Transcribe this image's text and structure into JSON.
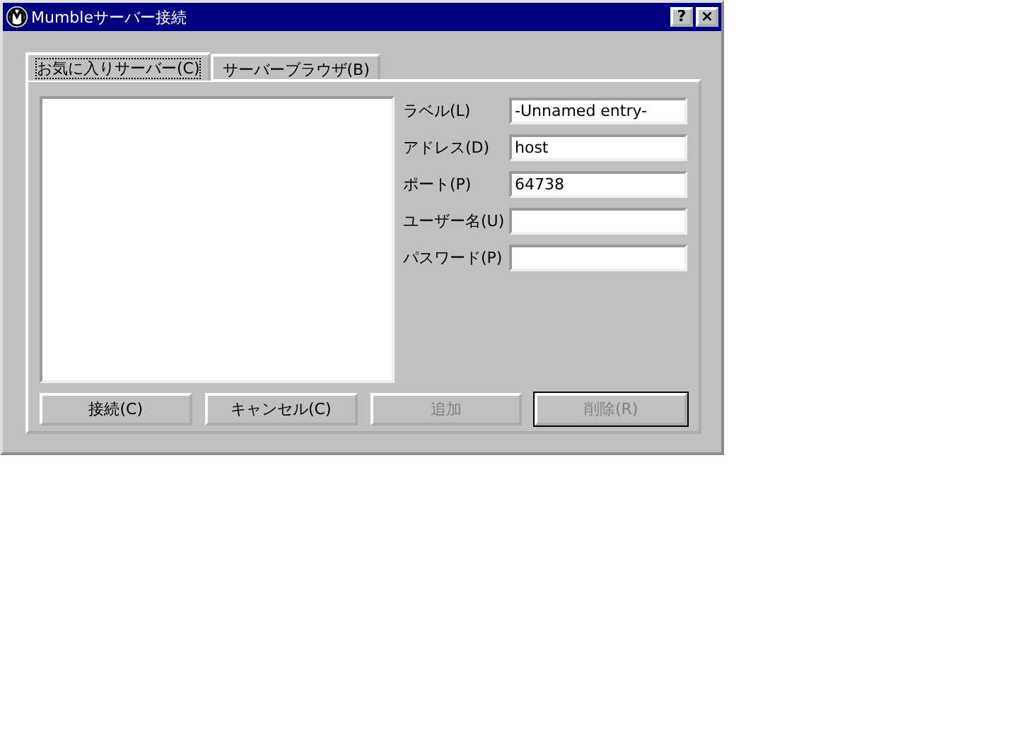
{
  "window": {
    "title": "Mumbleサーバー接続",
    "help": "?",
    "close": "×"
  },
  "tabs": [
    {
      "label": "お気に入りサーバー(C)",
      "selected": true
    },
    {
      "label": "サーバーブラウザ(B)",
      "selected": false
    }
  ],
  "fields": [
    {
      "label": "ラベル(L)",
      "value": "-Unnamed entry-"
    },
    {
      "label": "アドレス(D)",
      "value": "host"
    },
    {
      "label": "ポート(P)",
      "value": "64738"
    },
    {
      "label": "ユーザー名(U)"
    },
    {
      "label": "パスワード(P)"
    }
  ],
  "buttons": [
    {
      "label": "接続(C)",
      "disabled": false,
      "default": false
    },
    {
      "label": "キャンセル(C)",
      "disabled": false,
      "default": false
    },
    {
      "label": "追加",
      "disabled": true,
      "default": false
    },
    {
      "label": "削除(R)",
      "disabled": true,
      "default": true
    }
  ]
}
